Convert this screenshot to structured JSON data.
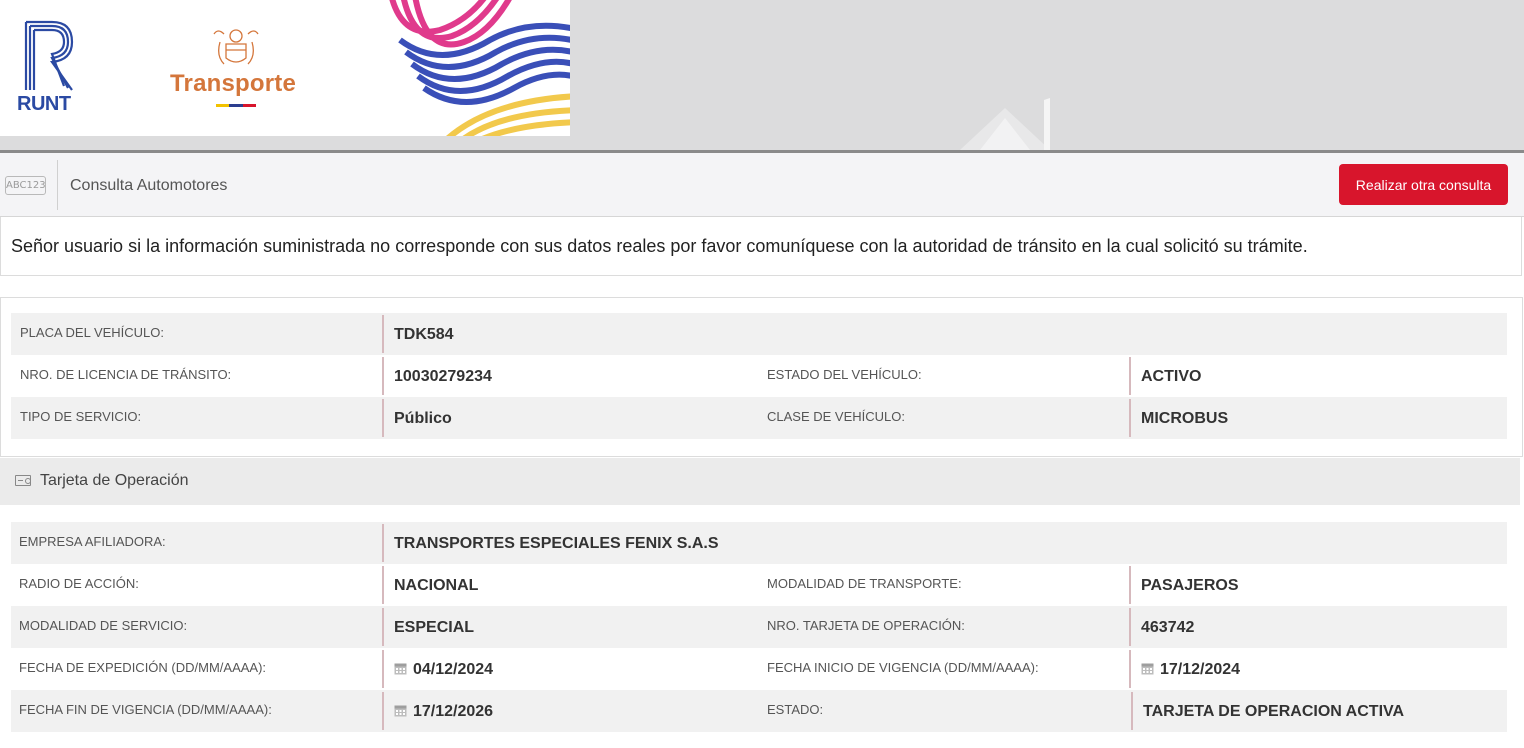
{
  "header": {
    "runt_logo_text": "RUNT",
    "ministry_logo_text": "Transporte"
  },
  "query_bar": {
    "icon_text": "ABC123",
    "title": "Consulta Automotores",
    "button_label": "Realizar otra consulta"
  },
  "notice": {
    "text": "Señor usuario si la información suministrada no corresponde con sus datos reales por favor comuníquese con la autoridad de tránsito en la cual solicitó su trámite."
  },
  "vehicle": {
    "placa_label": "PLACA DEL VEHÍCULO:",
    "placa_value": "TDK584",
    "licencia_label": "NRO. DE LICENCIA DE TRÁNSITO:",
    "licencia_value": "10030279234",
    "estado_label": "ESTADO DEL VEHÍCULO:",
    "estado_value": "ACTIVO",
    "servicio_label": "TIPO DE SERVICIO:",
    "servicio_value": "Público",
    "clase_label": "CLASE DE VEHÍCULO:",
    "clase_value": "MICROBUS"
  },
  "tarjeta": {
    "section_title": "Tarjeta de Operación",
    "empresa_label": "EMPRESA AFILIADORA:",
    "empresa_value": "TRANSPORTES ESPECIALES FENIX S.A.S",
    "radio_label": "RADIO DE ACCIÓN:",
    "radio_value": "NACIONAL",
    "modalidad_transporte_label": "MODALIDAD DE TRANSPORTE:",
    "modalidad_transporte_value": "PASAJEROS",
    "modalidad_servicio_label": "MODALIDAD DE SERVICIO:",
    "modalidad_servicio_value": "ESPECIAL",
    "nro_tarjeta_label": "NRO. TARJETA DE OPERACIÓN:",
    "nro_tarjeta_value": "463742",
    "fecha_expedicion_label": "FECHA DE EXPEDICIÓN (DD/MM/AAAA):",
    "fecha_expedicion_value": "04/12/2024",
    "fecha_inicio_label": "FECHA INICIO DE VIGENCIA (DD/MM/AAAA):",
    "fecha_inicio_value": "17/12/2024",
    "fecha_fin_label": "FECHA FIN DE VIGENCIA (DD/MM/AAAA):",
    "fecha_fin_value": "17/12/2026",
    "estado_label": "ESTADO:",
    "estado_value": "TARJETA DE OPERACION ACTIVA"
  },
  "colors": {
    "accent_button": "#d8152c",
    "runt_blue": "#2b4aa3",
    "transporte_orange": "#d4763b"
  }
}
